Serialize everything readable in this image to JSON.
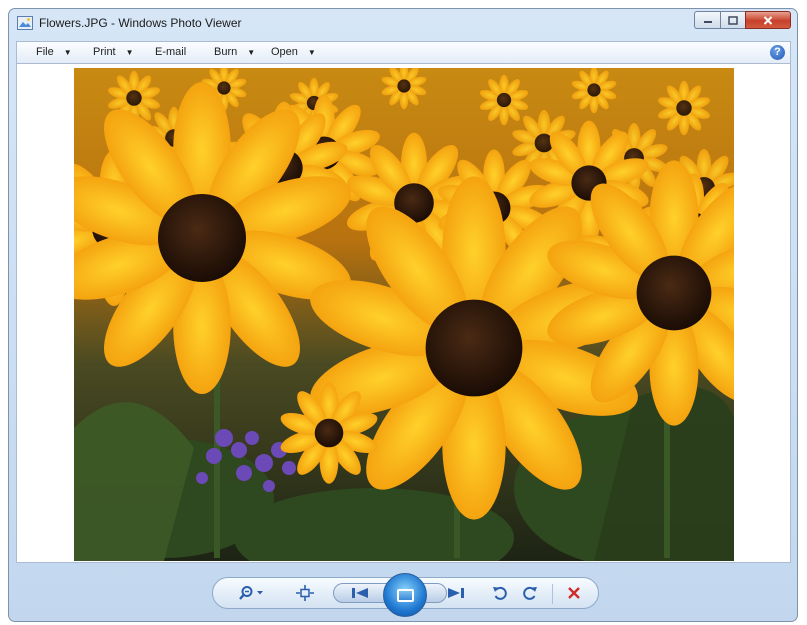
{
  "window": {
    "title": "Flowers.JPG - Windows Photo Viewer"
  },
  "menu": {
    "file": "File",
    "print": "Print",
    "email": "E-mail",
    "burn": "Burn",
    "open": "Open",
    "help": "?"
  },
  "image": {
    "subject": "flowers"
  },
  "toolbar": {
    "icons": [
      "zoom-icon",
      "actual-size-icon",
      "previous-icon",
      "slideshow-icon",
      "next-icon",
      "rotate-counterclockwise-icon",
      "rotate-clockwise-icon",
      "delete-icon"
    ]
  },
  "colors": {
    "accent": "#2a5fae",
    "delete": "#d02a2a",
    "close_button": "#c7412b"
  }
}
